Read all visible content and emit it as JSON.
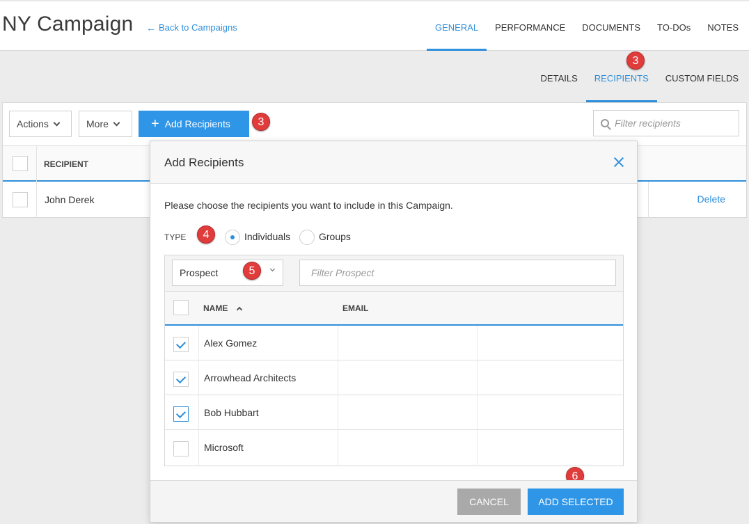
{
  "header": {
    "title": "NY Campaign",
    "back_link": "Back to Campaigns",
    "tabs": [
      {
        "label": "GENERAL",
        "active": true
      },
      {
        "label": "PERFORMANCE",
        "active": false
      },
      {
        "label": "DOCUMENTS",
        "active": false
      },
      {
        "label": "TO-DOs",
        "active": false
      },
      {
        "label": "NOTES",
        "active": false
      }
    ]
  },
  "subtabs": [
    {
      "label": "DETAILS",
      "active": false
    },
    {
      "label": "RECIPIENTS",
      "active": true
    },
    {
      "label": "CUSTOM FIELDS",
      "active": false
    }
  ],
  "toolbar": {
    "actions_label": "Actions",
    "more_label": "More",
    "add_recipients_label": "Add Recipients",
    "filter_placeholder": "Filter recipients"
  },
  "recipients_table": {
    "column_recipient": "RECIPIENT",
    "rows": [
      {
        "name": "John Derek",
        "action": "Delete"
      }
    ]
  },
  "modal": {
    "title": "Add Recipients",
    "intro": "Please choose the recipients you want to include in this Campaign.",
    "type_label": "TYPE",
    "type_options": [
      {
        "label": "Individuals",
        "selected": true
      },
      {
        "label": "Groups",
        "selected": false
      }
    ],
    "select_value": "Prospect",
    "filter_placeholder": "Filter Prospect",
    "columns": {
      "name": "NAME",
      "email": "EMAIL"
    },
    "rows": [
      {
        "name": "Alex Gomez",
        "checked": true
      },
      {
        "name": "Arrowhead Architects",
        "checked": true
      },
      {
        "name": "Bob Hubbart",
        "checked": true
      },
      {
        "name": "Microsoft",
        "checked": false
      }
    ],
    "cancel_label": "CANCEL",
    "add_label": "ADD SELECTED"
  },
  "callouts": [
    "3",
    "3",
    "4",
    "5",
    "6"
  ],
  "colors": {
    "accent": "#2f8fdb",
    "primary_button": "#2f95e6",
    "callout": "#e03c3c",
    "cancel_button": "#a9a9a9"
  }
}
